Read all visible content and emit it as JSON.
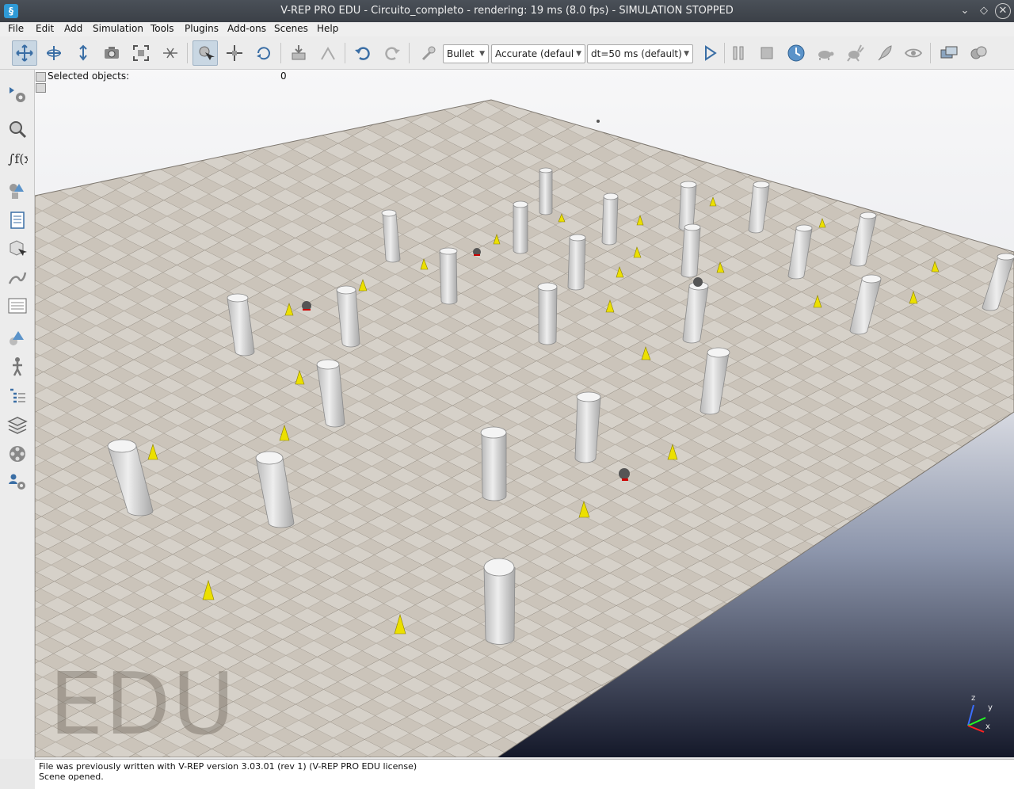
{
  "window": {
    "title": "V-REP PRO EDU - Circuito_completo - rendering: 19 ms (8.0 fps) - SIMULATION STOPPED",
    "app_icon": "vrep-logo-icon"
  },
  "menu": [
    "File",
    "Edit",
    "Add",
    "Simulation",
    "Tools",
    "Plugins",
    "Add-ons",
    "Scenes",
    "Help"
  ],
  "toolbar": {
    "icons": [
      "camera-pan-icon",
      "camera-rotate-icon",
      "camera-shift-icon",
      "camera-angle-icon",
      "fit-to-view-icon",
      "fly-icon",
      "click-select-icon",
      "object-shift-icon",
      "object-rotate-icon",
      "assemble-icon",
      "transfer-dna-icon",
      "undo-icon",
      "redo-icon",
      "verify-icon",
      "start-simulation-icon",
      "pause-simulation-icon",
      "stop-simulation-icon",
      "realtime-icon",
      "slow-down-icon",
      "speed-up-icon",
      "threaded-rendering-icon",
      "visualization-icon",
      "page-selector-icon",
      "view-selector-icon"
    ],
    "engine_select": "Bullet",
    "accuracy_select": "Accurate (default)",
    "timestep_select": "dt=50 ms (default)"
  },
  "sidebar": {
    "icons": [
      "simulation-settings-icon",
      "model-browser-icon",
      "calculation-modules-icon",
      "collections-icon",
      "scripts-icon",
      "shapes-icon",
      "paths-icon",
      "selection-icon",
      "object-properties-icon",
      "humanoid-icon",
      "scene-hierarchy-icon",
      "layers-icon",
      "video-recorder-icon",
      "user-settings-icon"
    ]
  },
  "scene": {
    "selected_label": "Selected objects:",
    "selected_count": "0",
    "watermark": "EDU",
    "axes": {
      "z": "z",
      "y": "y",
      "x": "x"
    }
  },
  "status": {
    "line1": "File was previously written with V-REP version 3.03.01 (rev 1) (V-REP PRO EDU license)",
    "line2": "Scene opened."
  }
}
